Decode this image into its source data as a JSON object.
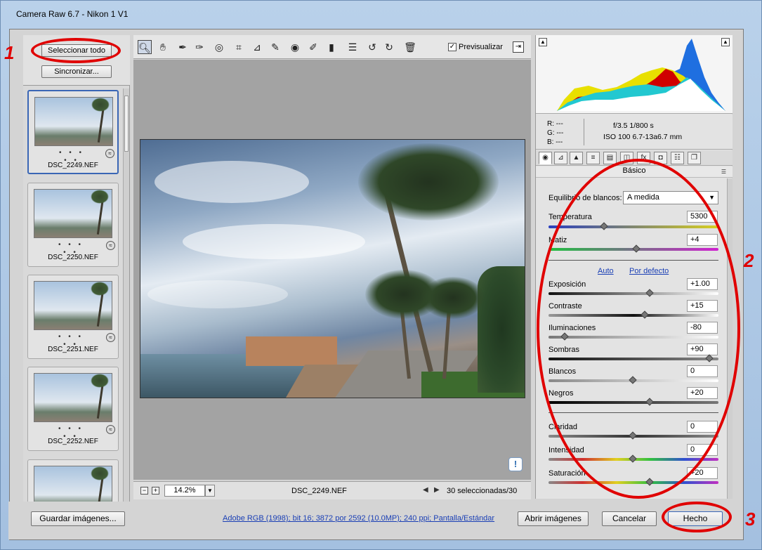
{
  "window": {
    "title": "Camera Raw 6.7 -  Nikon 1 V1"
  },
  "filmstrip": {
    "select_all_label": "Seleccionar todo",
    "sync_label": "Sincronizar...",
    "thumbs": [
      {
        "name": "DSC_2249.NEF",
        "stars": "• • • • •"
      },
      {
        "name": "DSC_2250.NEF",
        "stars": "• • • • •"
      },
      {
        "name": "DSC_2251.NEF",
        "stars": "• • • • •"
      },
      {
        "name": "DSC_2252.NEF",
        "stars": "• • • • •"
      },
      {
        "name": "",
        "stars": ""
      }
    ]
  },
  "toolbar": {
    "tools": [
      "zoom-tool",
      "hand-tool",
      "white-balance-tool",
      "color-sampler-tool",
      "target-adjustment-tool",
      "crop-tool",
      "straighten-tool",
      "spot-removal-tool",
      "red-eye-tool",
      "adjustment-brush-tool",
      "graduated-filter-tool",
      "preferences-tool",
      "rotate-left-tool",
      "rotate-right-tool",
      "trash-tool"
    ],
    "preview_label": "Previsualizar",
    "preview_checked": "✓"
  },
  "status": {
    "zoom": "14.2%",
    "filename": "DSC_2249.NEF",
    "selection": "30 seleccionadas/30"
  },
  "readout": {
    "r": "R:   ---",
    "g": "G:   ---",
    "b": "B:   ---",
    "aperture_shutter": "f/3.5   1/800 s",
    "iso_lens": "ISO 100   6.7-13a6.7 mm"
  },
  "panel": {
    "title": "Básico",
    "wb_label": "Equilibrio de blancos:",
    "wb_value": "A medida",
    "auto_label": "Auto",
    "default_label": "Por defecto",
    "sliders": [
      {
        "label": "Temperatura",
        "value": "5300",
        "position": 0.33
      },
      {
        "label": "Matiz",
        "value": "+4",
        "position": 0.52
      },
      {
        "label": "Exposición",
        "value": "+1.00",
        "position": 0.6
      },
      {
        "label": "Contraste",
        "value": "+15",
        "position": 0.57
      },
      {
        "label": "Iluminaciones",
        "value": "-80",
        "position": 0.1
      },
      {
        "label": "Sombras",
        "value": "+90",
        "position": 0.95
      },
      {
        "label": "Blancos",
        "value": "0",
        "position": 0.5
      },
      {
        "label": "Negros",
        "value": "+20",
        "position": 0.6
      },
      {
        "label": "Claridad",
        "value": "0",
        "position": 0.5
      },
      {
        "label": "Intensidad",
        "value": "0",
        "position": 0.5
      },
      {
        "label": "Saturación",
        "value": "+20",
        "position": 0.6
      }
    ]
  },
  "bottom": {
    "save_label": "Guardar imágenes...",
    "info_link": "Adobe RGB (1998); bit 16; 3872 por 2592 (10.0MP); 240 ppi; Pantalla/Estándar",
    "open_label": "Abrir imágenes",
    "cancel_label": "Cancelar",
    "done_label": "Hecho"
  },
  "annotations": {
    "one": "1",
    "two": "2",
    "three": "3"
  },
  "colors": {
    "annotation": "#e00000",
    "link": "#1a3fb5",
    "selection_border": "#3a66b5"
  }
}
